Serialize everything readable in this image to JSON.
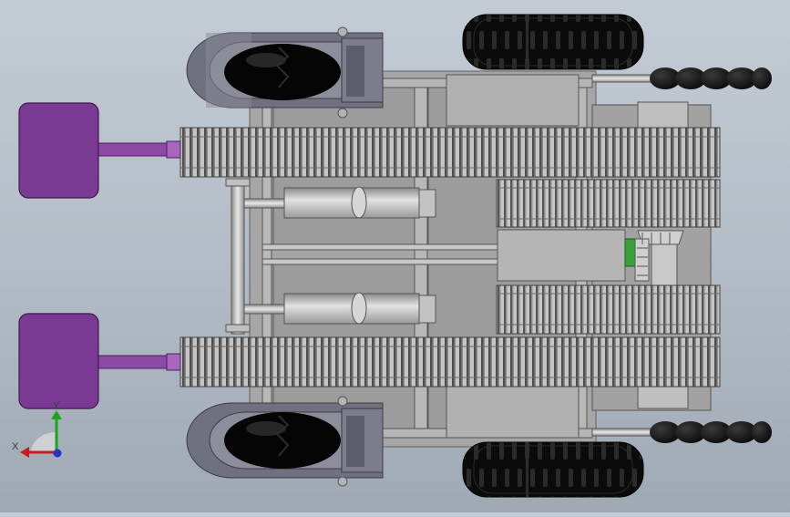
{
  "viewport": {
    "background_top": "#c3cbd4",
    "background_bottom": "#9fa9b4",
    "model": {
      "part_colors": {
        "frame": "#a9a9a9",
        "frame_dark": "#7c7c7c",
        "gear": "#b9b9b9",
        "tire": "#0d0d0d",
        "pad": "#7a3a93",
        "pad_stem": "#8c4aa6",
        "shaft_green": "#3aa13a",
        "roller": "#0a0a0a"
      }
    },
    "triad": {
      "x_label": "X",
      "y_label": "Y",
      "x_color": "#c61c1c",
      "y_color": "#1ea31e",
      "z_color": "#2233cc"
    }
  }
}
